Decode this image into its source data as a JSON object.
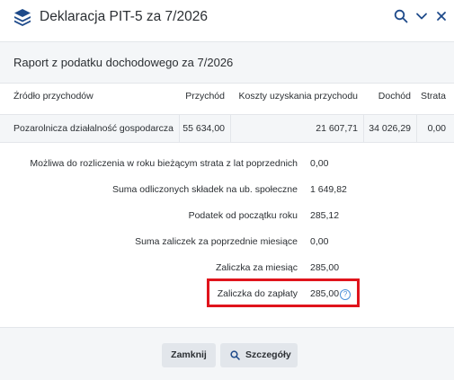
{
  "header": {
    "title": "Deklaracja PIT-5 za 7/2026",
    "icons": [
      "layers-icon",
      "search-icon",
      "chevron-down-icon",
      "close-icon"
    ]
  },
  "report": {
    "subtitle": "Raport z podatku dochodowego za 7/2026"
  },
  "table": {
    "columns": [
      "Źródło przychodów",
      "Przychód",
      "Koszty uzyskania przychodu",
      "Dochód",
      "Strata"
    ],
    "rows": [
      [
        "Pozarolnicza działalność gospodarcza",
        "55 634,00",
        "21 607,71",
        "34 026,29",
        "0,00"
      ]
    ]
  },
  "summary": [
    {
      "label": "Możliwa do rozliczenia w roku bieżącym strata z lat poprzednich",
      "value": "0,00"
    },
    {
      "label": "Suma odliczonych składek na ub. społeczne",
      "value": "1 649,82"
    },
    {
      "label": "Podatek od początku roku",
      "value": "285,12"
    },
    {
      "label": "Suma zaliczek za poprzednie miesiące",
      "value": "0,00"
    },
    {
      "label": "Zaliczka za miesiąc",
      "value": "285,00"
    },
    {
      "label": "Zaliczka do zapłaty",
      "value": "285,00"
    }
  ],
  "info_icon_glyph": "?",
  "footer": {
    "close_label": "Zamknij",
    "details_label": "Szczegóły"
  },
  "colors": {
    "highlight": "#e0141c",
    "accent": "#1e4a8a",
    "info": "#4a90d9"
  }
}
